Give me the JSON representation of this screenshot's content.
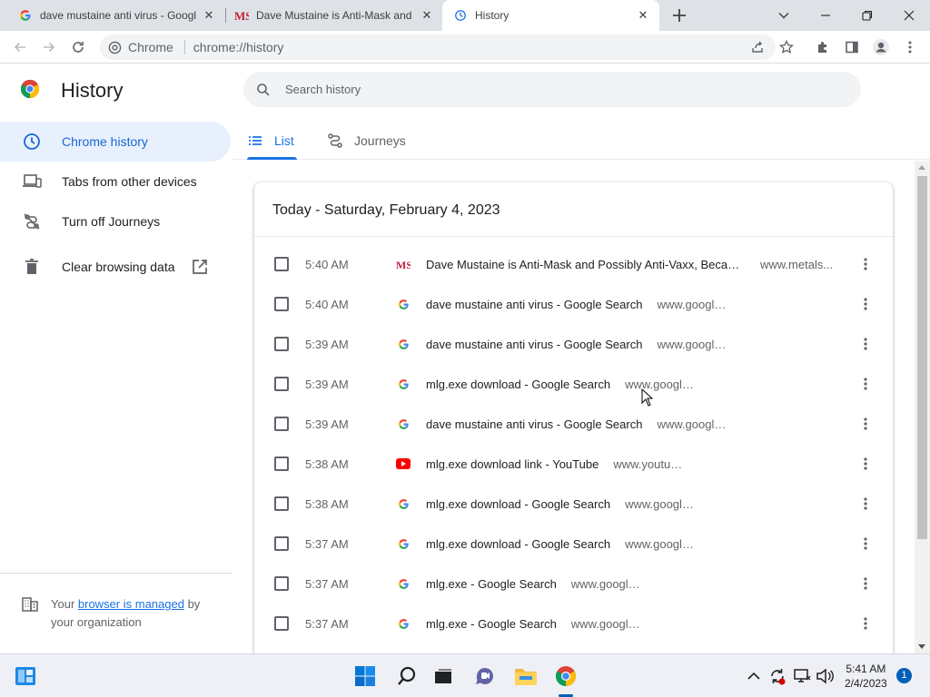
{
  "browser": {
    "tabs": [
      {
        "title": "dave mustaine anti virus - Google Search",
        "favicon": "google-favicon",
        "active": false
      },
      {
        "title": "Dave Mustaine is Anti-Mask and Possibly Anti-Vaxx, Because...",
        "favicon": "metalsucks-favicon",
        "active": false
      },
      {
        "title": "History",
        "favicon": "history-favicon",
        "active": true
      }
    ],
    "omnibox": {
      "chip_label": "Chrome",
      "url": "chrome://history"
    }
  },
  "header": {
    "title": "History",
    "search_placeholder": "Search history"
  },
  "sidebar": {
    "items": [
      {
        "label": "Chrome history",
        "icon": "clock-icon",
        "active": true
      },
      {
        "label": "Tabs from other devices",
        "icon": "devices-icon",
        "active": false
      },
      {
        "label": "Turn off Journeys",
        "icon": "journeys-off-icon",
        "active": false
      },
      {
        "label": "Clear browsing data",
        "icon": "trash-icon",
        "active": false
      }
    ],
    "managed": {
      "prefix": "Your ",
      "link": "browser is managed",
      "suffix": " by your organization"
    }
  },
  "view_tabs": {
    "list_label": "List",
    "journeys_label": "Journeys"
  },
  "history": {
    "date_heading": "Today - Saturday, February 4, 2023",
    "entries": [
      {
        "time": "5:40 AM",
        "favicon": "metalsucks-favicon",
        "title": "Dave Mustaine is Anti-Mask and Possibly Anti-Vaxx, Becaus...",
        "domain": "www.metals..."
      },
      {
        "time": "5:40 AM",
        "favicon": "google-favicon",
        "title": "dave mustaine anti virus - Google Search",
        "domain": "www.google.com"
      },
      {
        "time": "5:39 AM",
        "favicon": "google-favicon",
        "title": "dave mustaine anti virus - Google Search",
        "domain": "www.google.com"
      },
      {
        "time": "5:39 AM",
        "favicon": "google-favicon",
        "title": "mlg.exe download - Google Search",
        "domain": "www.google.com"
      },
      {
        "time": "5:39 AM",
        "favicon": "google-favicon",
        "title": "dave mustaine anti virus - Google Search",
        "domain": "www.google.com"
      },
      {
        "time": "5:38 AM",
        "favicon": "youtube-favicon",
        "title": "mlg.exe download link - YouTube",
        "domain": "www.youtube.com"
      },
      {
        "time": "5:38 AM",
        "favicon": "google-favicon",
        "title": "mlg.exe download - Google Search",
        "domain": "www.google.com"
      },
      {
        "time": "5:37 AM",
        "favicon": "google-favicon",
        "title": "mlg.exe download - Google Search",
        "domain": "www.google.com"
      },
      {
        "time": "5:37 AM",
        "favicon": "google-favicon",
        "title": "mlg.exe - Google Search",
        "domain": "www.google.com"
      },
      {
        "time": "5:37 AM",
        "favicon": "google-favicon",
        "title": "mlg.exe - Google Search",
        "domain": "www.google.com"
      }
    ]
  },
  "taskbar": {
    "time": "5:41 AM",
    "date": "2/4/2023",
    "notification_count": "1"
  },
  "colors": {
    "accent": "#1a73e8",
    "sidebar_active_bg": "#e8f0fe",
    "tabstrip_bg": "#dee1e6"
  }
}
